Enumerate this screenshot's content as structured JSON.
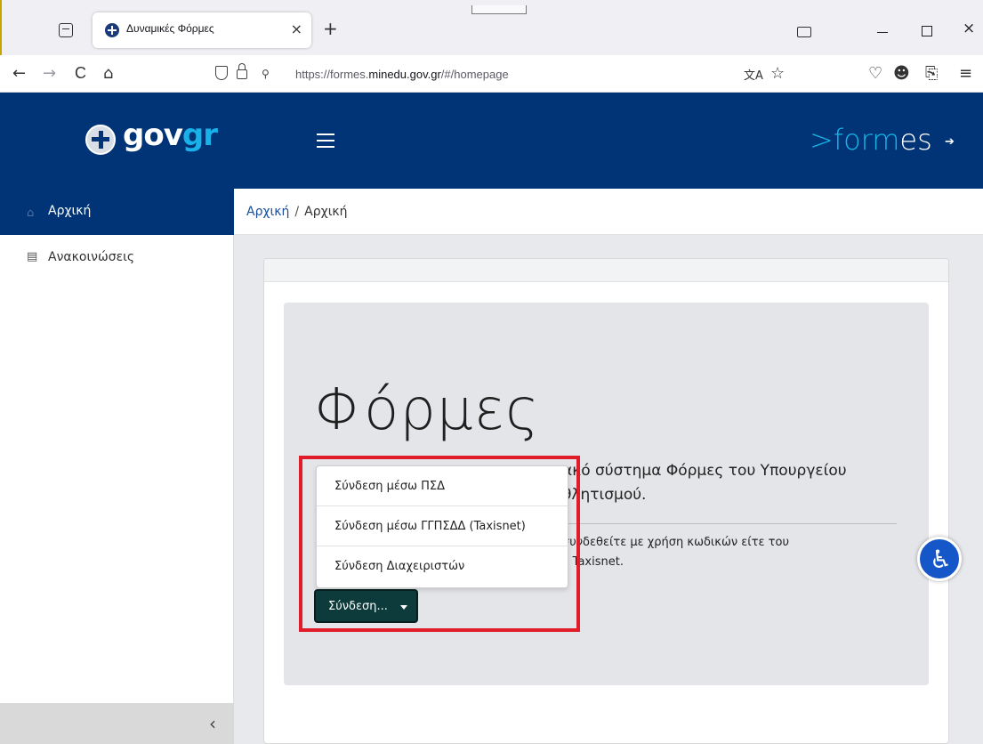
{
  "browser": {
    "tab_title": "Δυναμικές Φόρμες",
    "tab_close": "×",
    "new_tab": "+",
    "url_prefix": "https://formes.",
    "url_domain": "minedu.gov.gr",
    "url_path": "/#/homepage",
    "nav": {
      "back": "←",
      "forward": "→",
      "reload": "C",
      "home": "⌂"
    },
    "perm_icon": "⚲",
    "right_icons": {
      "translate": "文A",
      "bookmark": "☆",
      "pocket": "♡",
      "account": "☻",
      "extensions": "⎘",
      "menu": "≡"
    },
    "window": {
      "close": "×"
    }
  },
  "header": {
    "gov_logo_main": "gov",
    "gov_logo_accent": "gr",
    "formes_chevron": ">",
    "formes_fo": "fo",
    "formes_rm": "rm",
    "formes_es": "es",
    "login_icon": "➔"
  },
  "sidebar": {
    "items": [
      {
        "label": "Αρχική",
        "icon": "home-icon",
        "icon_glyph": "⌂",
        "active": true
      },
      {
        "label": "Ανακοινώσεις",
        "icon": "book-icon",
        "icon_glyph": "▤",
        "active": false
      }
    ],
    "collapse_glyph": "‹"
  },
  "breadcrumb": {
    "link": "Αρχική",
    "sep": "/",
    "current": "Αρχική"
  },
  "main": {
    "title": "Φόρμες",
    "lead_line1": "ακό σύστημα Φόρμες του Υπουργείου",
    "lead_line2": "θλητισμού.",
    "para_line1": "συνδεθείτε με χρήση κωδικών είτε του",
    "para_line2": "υ Taxisnet."
  },
  "dropdown": {
    "items": [
      "Σύνδεση μέσω ΠΣΔ",
      "Σύνδεση μέσω ΓΓΠΣΔΔ (Taxisnet)",
      "Σύνδεση Διαχειριστών"
    ],
    "button_label": "Σύνδεση..."
  },
  "colors": {
    "brand": "#003476",
    "accent": "#1ab0e8",
    "highlight": "#e21d2a",
    "button": "#0d3b3b"
  }
}
